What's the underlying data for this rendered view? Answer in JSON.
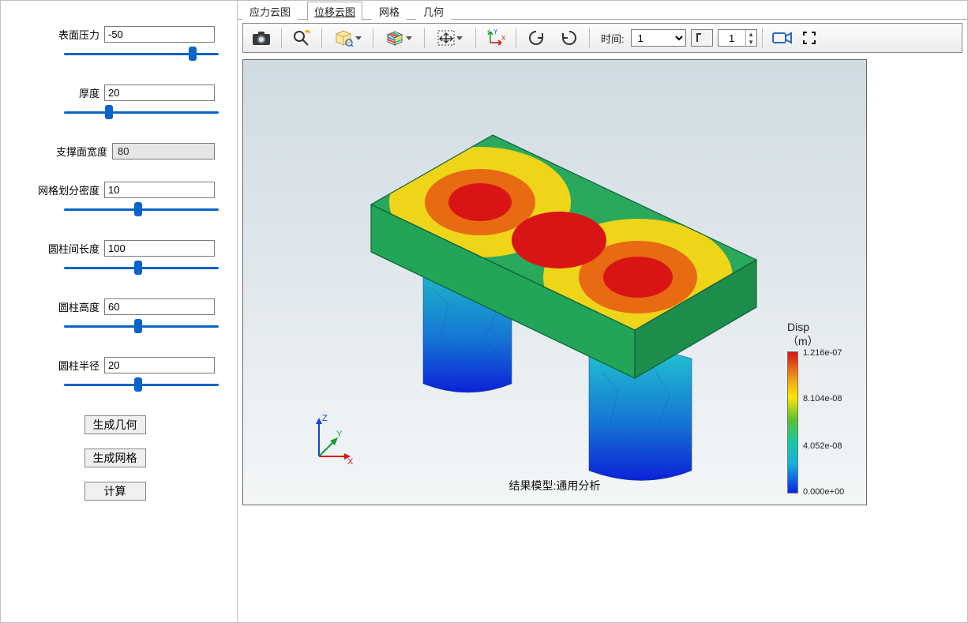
{
  "sidebar": {
    "params": [
      {
        "label": "表面压力",
        "value": "-50",
        "editable": true,
        "slider": 85
      },
      {
        "label": "厚度",
        "value": "20",
        "editable": true,
        "slider": 28
      },
      {
        "label": "支撑面宽度",
        "value": "80",
        "editable": false
      },
      {
        "label": "网格划分密度",
        "value": "10",
        "editable": true,
        "slider": 48
      },
      {
        "label": "圆柱间长度",
        "value": "100",
        "editable": true,
        "slider": 48
      },
      {
        "label": "圆柱高度",
        "value": "60",
        "editable": true,
        "slider": 48
      },
      {
        "label": "圆柱半径",
        "value": "20",
        "editable": true,
        "slider": 48
      }
    ],
    "buttons": [
      "生成几何",
      "生成网格",
      "计算"
    ]
  },
  "tabs": {
    "items": [
      "应力云图",
      "位移云图",
      "网格",
      "几何"
    ],
    "active": 1
  },
  "toolbar": {
    "time_label": "时间:",
    "time_value": "1",
    "frame_value": "1"
  },
  "viewport": {
    "caption": "结果模型:通用分析",
    "triad": {
      "x": "X",
      "y": "Y",
      "z": "Z"
    },
    "legend": {
      "title1": "Disp",
      "title2": "（m）",
      "ticks": [
        "1.216e-07",
        "8.104e-08",
        "4.052e-08",
        "0.000e+00"
      ]
    }
  }
}
